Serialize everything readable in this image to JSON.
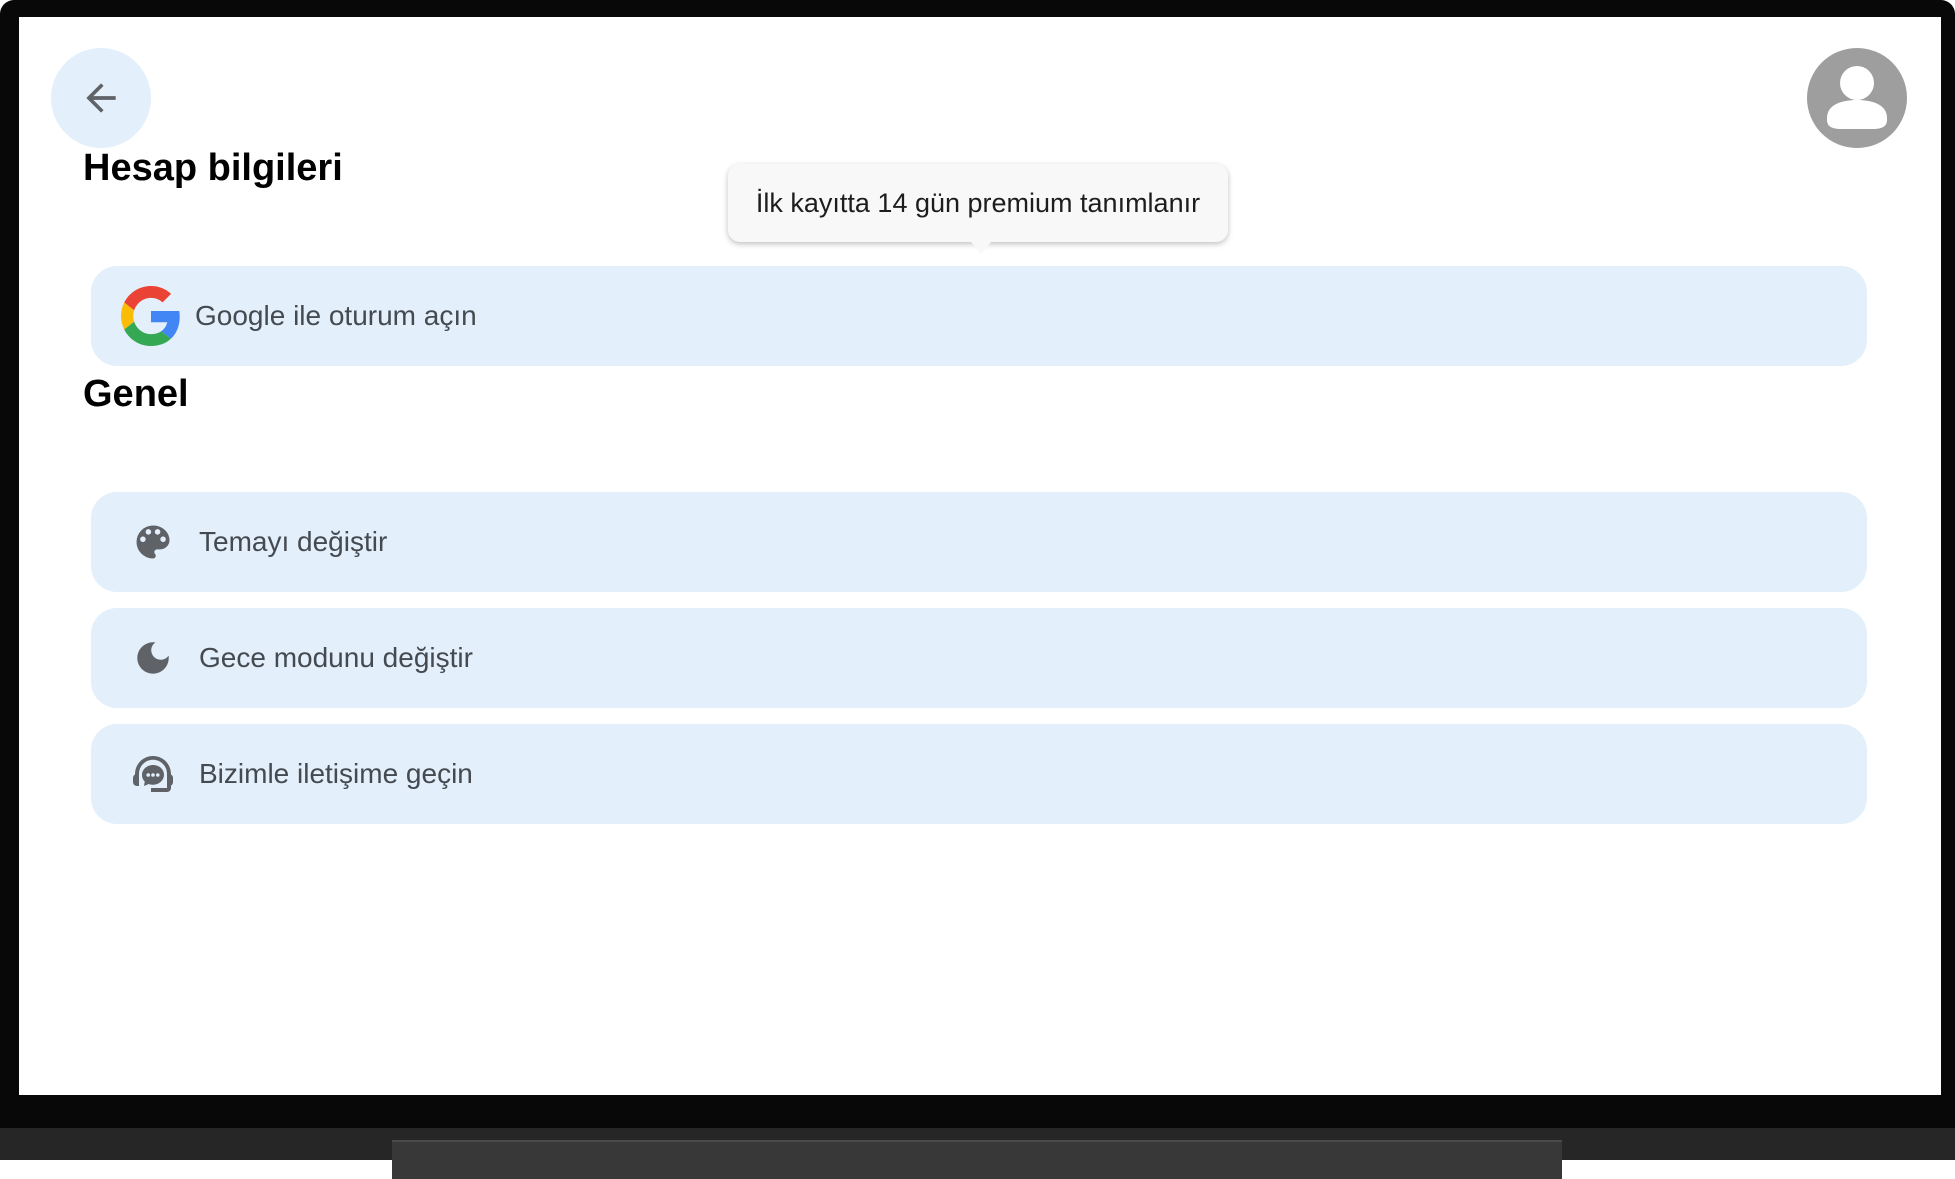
{
  "header": {
    "back_icon": "arrow-left-icon",
    "profile_icon": "account-circle-icon"
  },
  "tooltip": {
    "text": "İlk kayıtta 14 gün premium tanımlanır"
  },
  "account_section": {
    "title": "Hesap bilgileri",
    "google_signin": {
      "icon": "google-logo-icon",
      "label": "Google ile oturum açın"
    }
  },
  "general_section": {
    "title": "Genel",
    "items": [
      {
        "icon": "palette-icon",
        "label": "Temayı değiştir"
      },
      {
        "icon": "moon-icon",
        "label": "Gece modunu değiştir"
      },
      {
        "icon": "support-chat-icon",
        "label": "Bizimle iletişime geçin"
      }
    ]
  },
  "colors": {
    "row_background": "#e3effb",
    "back_button_background": "#e3effb",
    "avatar_background": "#9e9e9e",
    "icon_color": "#5f6368",
    "google_blue": "#4285F4",
    "google_red": "#EA4335",
    "google_yellow": "#FBBC05",
    "google_green": "#34A853"
  }
}
